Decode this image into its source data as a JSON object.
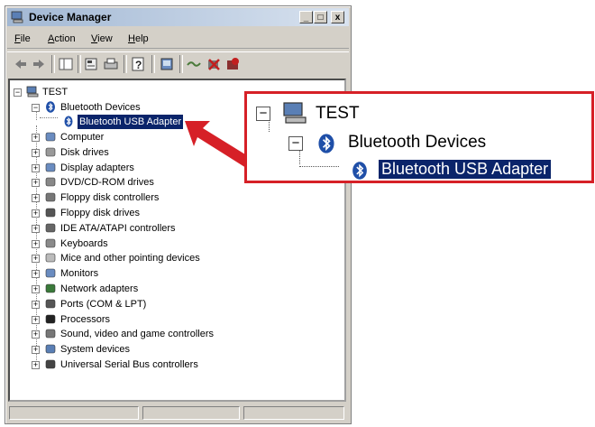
{
  "window": {
    "title": "Device Manager",
    "controls": {
      "minimize": "_",
      "maximize": "□",
      "close": "x"
    }
  },
  "menu": {
    "items": [
      {
        "label": "File",
        "mnemonic": "F",
        "rest": "ile"
      },
      {
        "label": "Action",
        "mnemonic": "A",
        "rest": "ction"
      },
      {
        "label": "View",
        "mnemonic": "V",
        "rest": "iew"
      },
      {
        "label": "Help",
        "mnemonic": "H",
        "rest": "elp"
      }
    ]
  },
  "toolbar": {
    "icons": [
      "back-arrow-icon",
      "forward-arrow-icon",
      "show-hide-tree-icon",
      "properties-icon",
      "print-icon",
      "help-icon",
      "scan-hardware-icon",
      "update-driver-icon",
      "uninstall-icon",
      "disable-icon"
    ]
  },
  "tree": {
    "root": {
      "label": "TEST",
      "expander": "−"
    },
    "bluetooth": {
      "label": "Bluetooth Devices",
      "expander": "−"
    },
    "adapter": {
      "label": "Bluetooth USB Adapter"
    },
    "categories": [
      {
        "label": "Computer",
        "icon": "computer-icon"
      },
      {
        "label": "Disk drives",
        "icon": "disk-drive-icon"
      },
      {
        "label": "Display adapters",
        "icon": "display-adapter-icon"
      },
      {
        "label": "DVD/CD-ROM drives",
        "icon": "cdrom-icon"
      },
      {
        "label": "Floppy disk controllers",
        "icon": "floppy-controller-icon"
      },
      {
        "label": "Floppy disk drives",
        "icon": "floppy-drive-icon"
      },
      {
        "label": "IDE ATA/ATAPI controllers",
        "icon": "ide-controller-icon"
      },
      {
        "label": "Keyboards",
        "icon": "keyboard-icon"
      },
      {
        "label": "Mice and other pointing devices",
        "icon": "mouse-icon"
      },
      {
        "label": "Monitors",
        "icon": "monitor-icon"
      },
      {
        "label": "Network adapters",
        "icon": "network-adapter-icon"
      },
      {
        "label": "Ports (COM & LPT)",
        "icon": "port-icon"
      },
      {
        "label": "Processors",
        "icon": "processor-icon"
      },
      {
        "label": "Sound, video and game controllers",
        "icon": "sound-icon"
      },
      {
        "label": "System devices",
        "icon": "system-device-icon"
      },
      {
        "label": "Universal Serial Bus controllers",
        "icon": "usb-icon"
      }
    ],
    "collapsed_expander": "+"
  },
  "zoom_callout": {
    "root": "TEST",
    "bluetooth": "Bluetooth Devices",
    "adapter": "Bluetooth USB Adapter"
  },
  "colors": {
    "selection": "#0a246a",
    "callout_border": "#d62027",
    "bluetooth_blue": "#1f4fa8"
  }
}
